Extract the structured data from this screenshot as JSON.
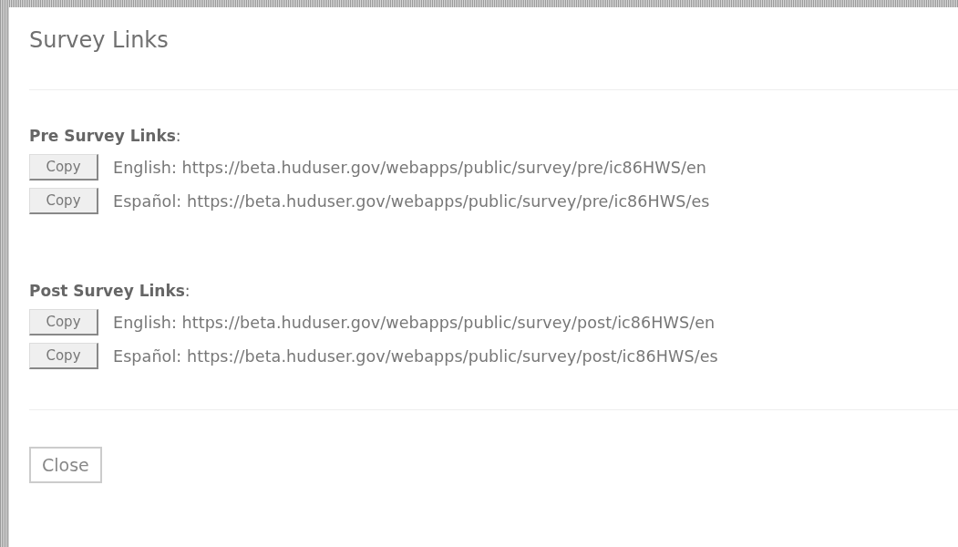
{
  "dialog": {
    "title": "Survey Links"
  },
  "sections": [
    {
      "heading": "**Pre Survey Links**:",
      "links": [
        {
          "button": "Copy",
          "text": "English: https://beta.huduser.gov/webapps/public/survey/pre/ic86HWS/en"
        },
        {
          "button": "Copy",
          "text": "Español: https://beta.huduser.gov/webapps/public/survey/pre/ic86HWS/es"
        }
      ]
    },
    {
      "heading": "**Post Survey Links**:",
      "links": [
        {
          "button": "Copy",
          "text": "English: https://beta.huduser.gov/webapps/public/survey/post/ic86HWS/en"
        },
        {
          "button": "Copy",
          "text": "Español: https://beta.huduser.gov/webapps/public/survey/post/ic86HWS/es"
        }
      ]
    }
  ],
  "close_button": "Close"
}
